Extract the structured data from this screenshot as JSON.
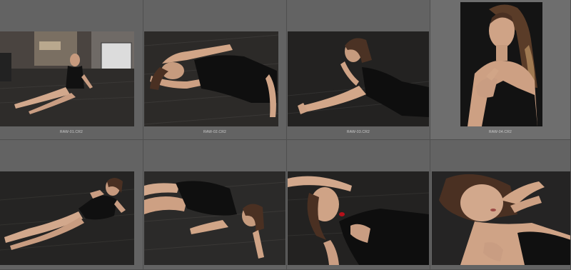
{
  "grid": {
    "cells": [
      {
        "filename": "RAW-01.CR2",
        "image": "woman-sitting-in-room-photo"
      },
      {
        "filename": "RAW-02.CR2",
        "image": "woman-lying-on-floor-arms-up-photo"
      },
      {
        "filename": "RAW-03.CR2",
        "image": "woman-lying-hand-on-chin-photo"
      },
      {
        "filename": "RAW-04.CR2",
        "image": "woman-portrait-vertical-photo"
      },
      {
        "filename": "",
        "image": "woman-reclining-on-floor-photo"
      },
      {
        "filename": "",
        "image": "woman-lying-on-side-photo"
      },
      {
        "filename": "",
        "image": "woman-lying-red-lips-photo"
      },
      {
        "filename": "",
        "image": "woman-closeup-hand-on-face-photo"
      }
    ]
  }
}
